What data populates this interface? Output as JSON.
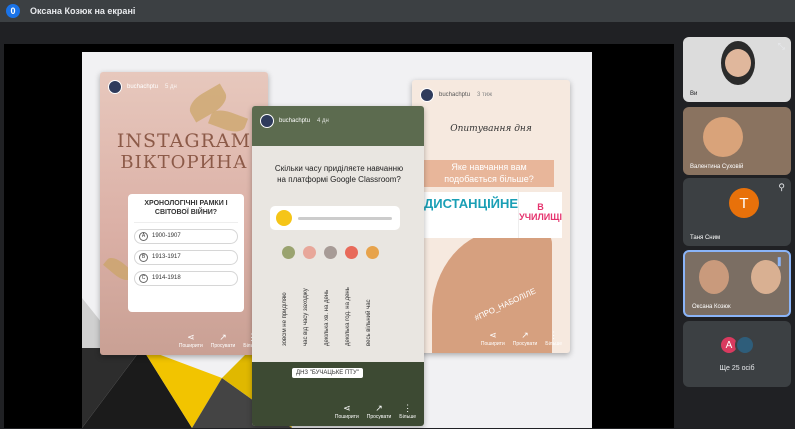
{
  "topbar": {
    "badge": "0",
    "title": "Оксана Козюк на екрані"
  },
  "story1": {
    "handle": "buchachptu",
    "ago": "5 дн",
    "title_line1": "INSTAGRAM",
    "title_line2": "ВІКТОРИНА",
    "question": "ХРОНОЛОГІЧНІ РАМКИ І СВІТОВОЇ ВІЙНИ?",
    "options": [
      {
        "letter": "A",
        "text": "1900-1907"
      },
      {
        "letter": "B",
        "text": "1913-1917"
      },
      {
        "letter": "C",
        "text": "1914-1918"
      }
    ],
    "actions": [
      "Поширити",
      "Просувати",
      "Більше"
    ]
  },
  "story2": {
    "handle": "buchachptu",
    "ago": "4 дн",
    "question": "Скільки часу приділяєте навчанню на платформі Google Classroom?",
    "dot_colors": [
      "#9aa36f",
      "#e8a79a",
      "#a79b96",
      "#e86a5a",
      "#e7a34b"
    ],
    "columns": [
      "зовсім не приділяю",
      "час від часу заходжу",
      "декілька хв. на день",
      "декілька год. на день",
      "весь вільний час"
    ],
    "tag": "ДНЗ \"БУЧАЦЬКЕ ПТУ\"",
    "actions": [
      "Поширити",
      "Просувати",
      "Більше"
    ]
  },
  "story3": {
    "handle": "buchachptu",
    "ago": "3 тиж",
    "title": "Опитування дня",
    "question": "Яке навчання вам подобається більше?",
    "option1": "ДИСТАНЦІЙНЕ",
    "option2": "В УЧИЛИЩІ",
    "hashtag": "#ПРО_НАБОЛІЛЕ",
    "actions": [
      "Поширити",
      "Просувати",
      "Більше"
    ]
  },
  "sidebar": {
    "tiles": [
      {
        "name": "Ви"
      },
      {
        "name": "Валентина Суховій"
      },
      {
        "name": "Таня Сним",
        "initial": "Т"
      },
      {
        "name": "Оксана Козюк"
      },
      {
        "name": "Ще 25 осіб",
        "avatar_initial": "A"
      }
    ]
  },
  "colors": {
    "accent": "#1a73e8",
    "tile_highlight": "#8ab4f8",
    "avatar_orange": "#e8710a",
    "avatar_pink": "#d93a5f"
  }
}
